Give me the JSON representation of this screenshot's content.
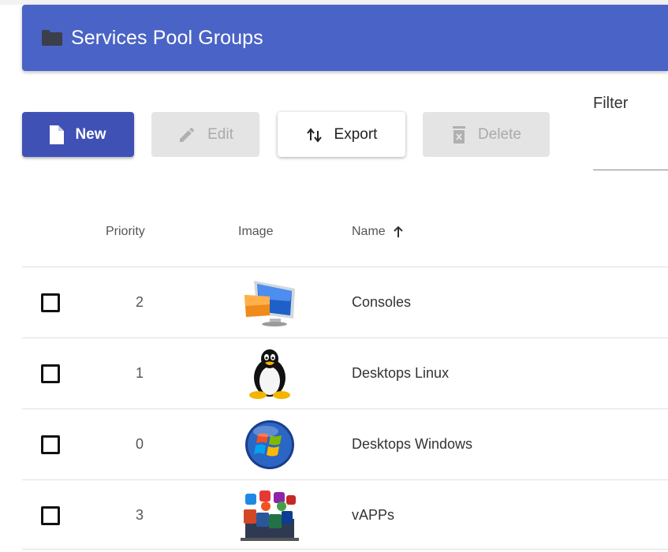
{
  "header": {
    "title": "Services Pool Groups",
    "icon": "folder-icon",
    "color": "#4a63c6"
  },
  "toolbar": {
    "new_label": "New",
    "edit_label": "Edit",
    "export_label": "Export",
    "delete_label": "Delete",
    "filter_label": "Filter",
    "filter_value": ""
  },
  "table": {
    "columns": [
      "Priority",
      "Image",
      "Name"
    ],
    "sort_column": "Name",
    "sort_direction": "ascending",
    "rows": [
      {
        "priority": "2",
        "image": "monitor-icon",
        "name": "Consoles"
      },
      {
        "priority": "1",
        "image": "tux-icon",
        "name": "Desktops Linux"
      },
      {
        "priority": "0",
        "image": "windows-logo-icon",
        "name": "Desktops Windows"
      },
      {
        "priority": "3",
        "image": "apps-icon",
        "name": "vAPPs"
      }
    ]
  },
  "colors": {
    "accent": "#3f51b5",
    "disabled": "#e4e4e4"
  }
}
